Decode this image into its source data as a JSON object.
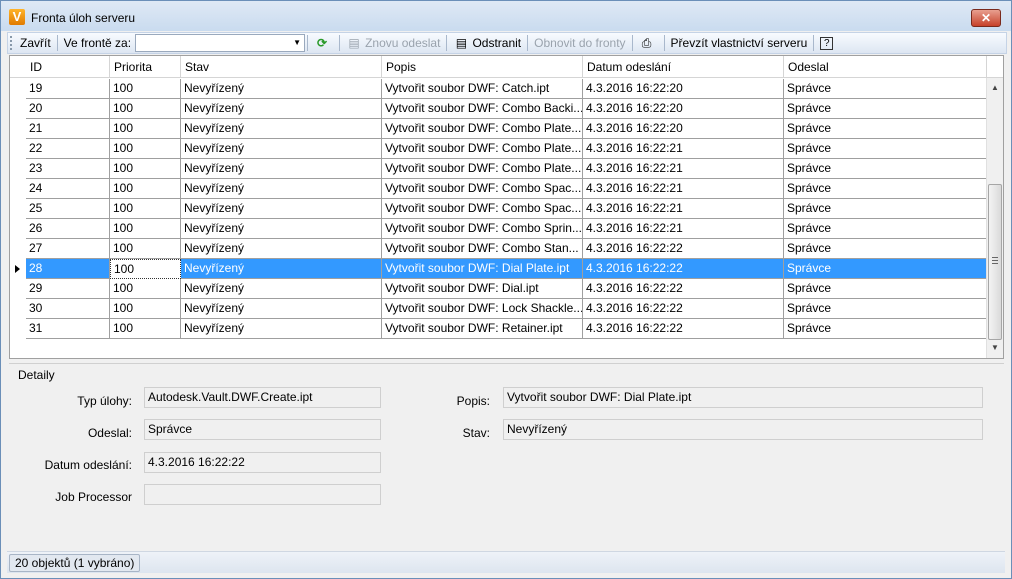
{
  "window": {
    "title": "Fronta úloh serveru",
    "close_label": "✕"
  },
  "toolbar": {
    "close_label": "Zavřít",
    "queue_label": "Ve frontě za:",
    "queue_value": "",
    "resubmit_label": "Znovu odeslat",
    "remove_label": "Odstranit",
    "restore_label": "Obnovit do fronty",
    "take_ownership_label": "Převzít vlastnictví serveru",
    "help_label": "?"
  },
  "grid": {
    "columns": [
      "ID",
      "Priorita",
      "Stav",
      "Popis",
      "Datum odeslání",
      "Odeslal"
    ],
    "rows": [
      [
        "19",
        "100",
        "Nevyřízený",
        "Vytvořit soubor DWF: Catch.ipt",
        "4.3.2016 16:22:20",
        "Správce"
      ],
      [
        "20",
        "100",
        "Nevyřízený",
        "Vytvořit soubor DWF: Combo Backi...",
        "4.3.2016 16:22:20",
        "Správce"
      ],
      [
        "21",
        "100",
        "Nevyřízený",
        "Vytvořit soubor DWF: Combo Plate...",
        "4.3.2016 16:22:20",
        "Správce"
      ],
      [
        "22",
        "100",
        "Nevyřízený",
        "Vytvořit soubor DWF: Combo Plate...",
        "4.3.2016 16:22:21",
        "Správce"
      ],
      [
        "23",
        "100",
        "Nevyřízený",
        "Vytvořit soubor DWF: Combo Plate...",
        "4.3.2016 16:22:21",
        "Správce"
      ],
      [
        "24",
        "100",
        "Nevyřízený",
        "Vytvořit soubor DWF: Combo Spac...",
        "4.3.2016 16:22:21",
        "Správce"
      ],
      [
        "25",
        "100",
        "Nevyřízený",
        "Vytvořit soubor DWF: Combo Spac...",
        "4.3.2016 16:22:21",
        "Správce"
      ],
      [
        "26",
        "100",
        "Nevyřízený",
        "Vytvořit soubor DWF: Combo Sprin...",
        "4.3.2016 16:22:21",
        "Správce"
      ],
      [
        "27",
        "100",
        "Nevyřízený",
        "Vytvořit soubor DWF: Combo Stan...",
        "4.3.2016 16:22:22",
        "Správce"
      ],
      [
        "28",
        "100",
        "Nevyřízený",
        "Vytvořit soubor DWF: Dial Plate.ipt",
        "4.3.2016 16:22:22",
        "Správce"
      ],
      [
        "29",
        "100",
        "Nevyřízený",
        "Vytvořit soubor DWF: Dial.ipt",
        "4.3.2016 16:22:22",
        "Správce"
      ],
      [
        "30",
        "100",
        "Nevyřízený",
        "Vytvořit soubor DWF: Lock Shackle...",
        "4.3.2016 16:22:22",
        "Správce"
      ],
      [
        "31",
        "100",
        "Nevyřízený",
        "Vytvořit soubor DWF: Retainer.ipt",
        "4.3.2016 16:22:22",
        "Správce"
      ]
    ],
    "selected_index": 9
  },
  "details": {
    "title": "Detaily",
    "job_type_label": "Typ úlohy:",
    "job_type_value": "Autodesk.Vault.DWF.Create.ipt",
    "submitter_label": "Odeslal:",
    "submitter_value": "Správce",
    "date_label": "Datum odeslání:",
    "date_value": "4.3.2016 16:22:22",
    "processor_label": "Job Processor",
    "processor_value": "",
    "description_label": "Popis:",
    "description_value": "Vytvořit soubor DWF: Dial Plate.ipt",
    "status_label": "Stav:",
    "status_value": "Nevyřízený"
  },
  "status": {
    "text": "20 objektů (1 vybráno)"
  },
  "colors": {
    "selection": "#3399ff",
    "accent": "#6b8fb8"
  }
}
